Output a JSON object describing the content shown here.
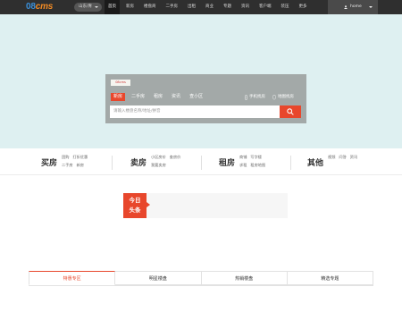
{
  "header": {
    "logo_part1": "08",
    "logo_part2": "cms",
    "city": "山东/青",
    "nav": [
      "首页",
      "新房",
      "楼盘商",
      "二手房",
      "出租",
      "商业",
      "专题",
      "资讯",
      "客户端",
      "装压",
      "更多"
    ],
    "user": "home"
  },
  "search": {
    "logo_text": "08cms",
    "tabs": [
      "新房",
      "二手房",
      "租房",
      "资讯",
      "查小区"
    ],
    "right_links": [
      "手机找房",
      "地图找房"
    ],
    "placeholder": "请输入楼盘名称/地址/拼音"
  },
  "categories": [
    {
      "title": "买房",
      "links": [
        "团购",
        "打折优惠",
        "二手房",
        "新房"
      ]
    },
    {
      "title": "卖房",
      "links": [
        "小区房价",
        "查房价",
        "我要卖房"
      ]
    },
    {
      "title": "租房",
      "links": [
        "商铺",
        "写字楼",
        "求租",
        "租房地图"
      ]
    },
    {
      "title": "其他",
      "links": [
        "视频",
        "问答",
        "资讯"
      ]
    }
  ],
  "toutiao": {
    "line1": "今日",
    "line2": "头条"
  },
  "bottom_tabs": [
    "特惠专区",
    "明星楼盘",
    "热销楼盘",
    "精选专题"
  ],
  "colors": {
    "accent": "#e8472c",
    "topbar": "#2f2f2f",
    "hero": "#def0f1",
    "searchbox": "#a3a9a8"
  },
  "icons": {
    "user": "user-icon",
    "phone": "phone-icon",
    "map": "map-pin-icon",
    "search": "search-icon"
  }
}
